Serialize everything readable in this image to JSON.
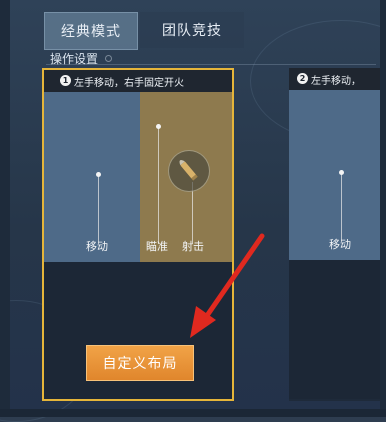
{
  "tabs": [
    {
      "label": "经典模式",
      "active": true
    },
    {
      "label": "团队竞技",
      "active": false
    }
  ],
  "section_label": "操作设置",
  "layouts": [
    {
      "number": "1",
      "title": "左手移动，右手固定开火",
      "zones": {
        "move": "移动",
        "aim": "瞄准",
        "fire": "射击"
      },
      "selected": true
    },
    {
      "number": "2",
      "title": "左手移动，",
      "zones": {
        "move": "移动"
      },
      "selected": false
    }
  ],
  "custom_button_label": "自定义布局",
  "icons": [
    "bullet-icon",
    "red-arrow-indicator"
  ],
  "colors": {
    "selected_border": "#e5b53a",
    "button": "#e8923a",
    "arrow": "#e0291f"
  }
}
